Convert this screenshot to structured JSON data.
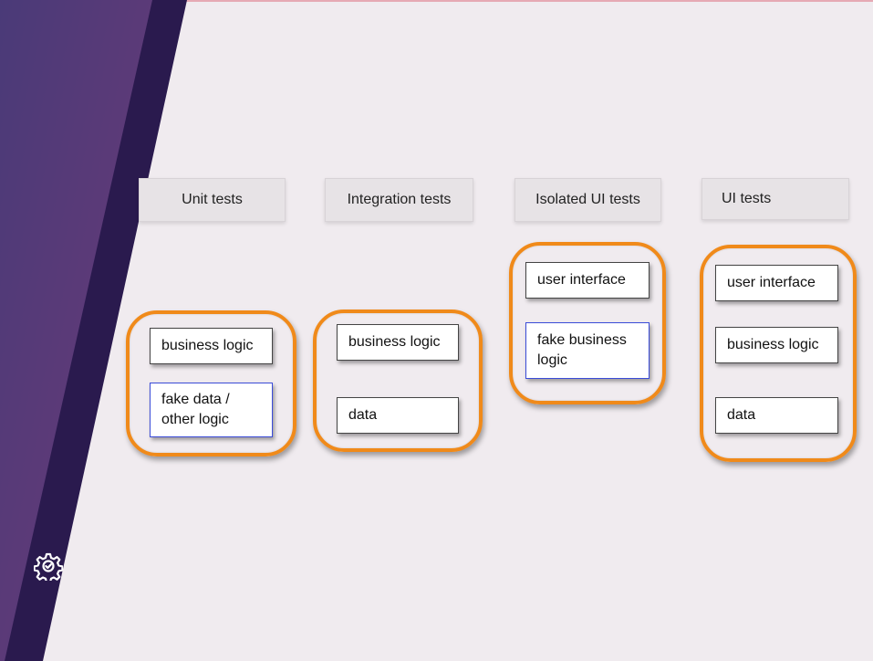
{
  "columns": [
    {
      "header": "Unit tests",
      "boxes": [
        {
          "label": "business logic",
          "fake": false
        },
        {
          "label": "fake data / other logic",
          "fake": true
        }
      ]
    },
    {
      "header": "Integration tests",
      "boxes": [
        {
          "label": "business logic",
          "fake": false
        },
        {
          "label": "data",
          "fake": false
        }
      ]
    },
    {
      "header": "Isolated UI tests",
      "boxes": [
        {
          "label": "user interface",
          "fake": false
        },
        {
          "label": "fake business logic",
          "fake": true
        }
      ]
    },
    {
      "header": "UI tests",
      "boxes": [
        {
          "label": "user interface",
          "fake": false
        },
        {
          "label": "business logic",
          "fake": false
        },
        {
          "label": "data",
          "fake": false
        }
      ]
    }
  ],
  "icons": {
    "settings": "settings-gear-icon"
  },
  "colors": {
    "background": "#f0ebef",
    "group_border": "#f08a1a",
    "fake_border": "#3b4cd8",
    "sidebar_purple": "#4e3672",
    "sidebar_dark": "#2a1a4e"
  }
}
